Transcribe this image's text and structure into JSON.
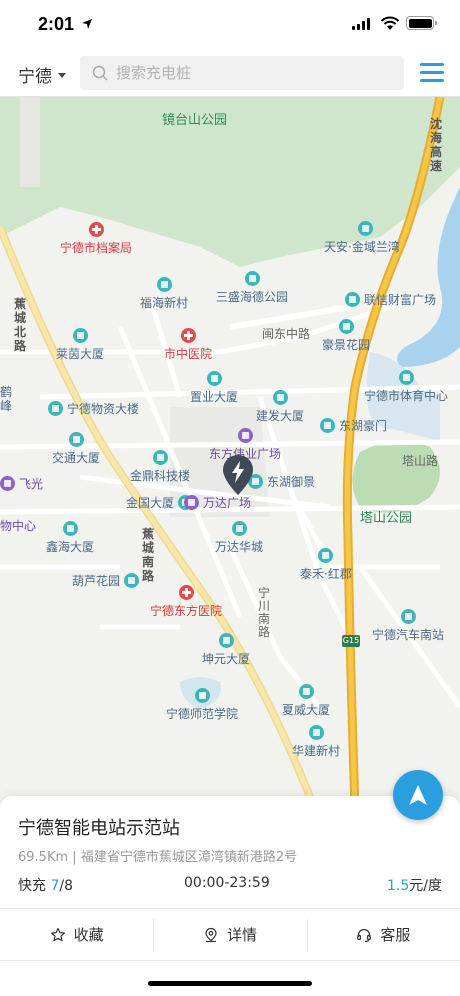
{
  "status_bar": {
    "time": "2:01"
  },
  "header": {
    "city": "宁德",
    "search_placeholder": "搜索充电桩"
  },
  "map": {
    "parks": [
      "镜台山公园",
      "塔山公园"
    ],
    "roads": [
      "沈海高速",
      "蕉城北路",
      "蕉城南路",
      "闽东中路",
      "塔山路",
      "宁川南路",
      "G15"
    ],
    "pois": [
      "宁德市档案局",
      "天安·金域兰湾",
      "福海新村",
      "三盛海德公园",
      "联信财富广场",
      "莱茵大厦",
      "市中医院",
      "豪景花园",
      "宁德市体育中心",
      "宁德物资大楼",
      "置业大厦",
      "建发大厦",
      "东湖豪门",
      "交通大厦",
      "东方伟业广场",
      "金鼎科技楼",
      "东湖御景",
      "金国大厦",
      "万达广场",
      "鑫海大厦",
      "万达华城",
      "泰禾·红郡",
      "葫芦花园",
      "宁德东方医院",
      "宁德汽车南站",
      "坤元大厦",
      "夏威大厦",
      "宁德师范学院",
      "华建新村",
      "鹤峰",
      "飞光",
      "物中心"
    ]
  },
  "station": {
    "name": "宁德智能电站示范站",
    "distance": "69.5Km",
    "separator": "|",
    "address": "福建省宁德市蕉城区漳湾镇新港路2号",
    "fast_label": "快充",
    "fast_available": "7",
    "fast_total": "/8",
    "hours": "00:00-23:59",
    "price_value": "1.5",
    "price_unit": "元/度"
  },
  "actions": {
    "favorite": "收藏",
    "details": "详情",
    "service": "客服"
  },
  "colors": {
    "accent": "#2a9fe0"
  }
}
